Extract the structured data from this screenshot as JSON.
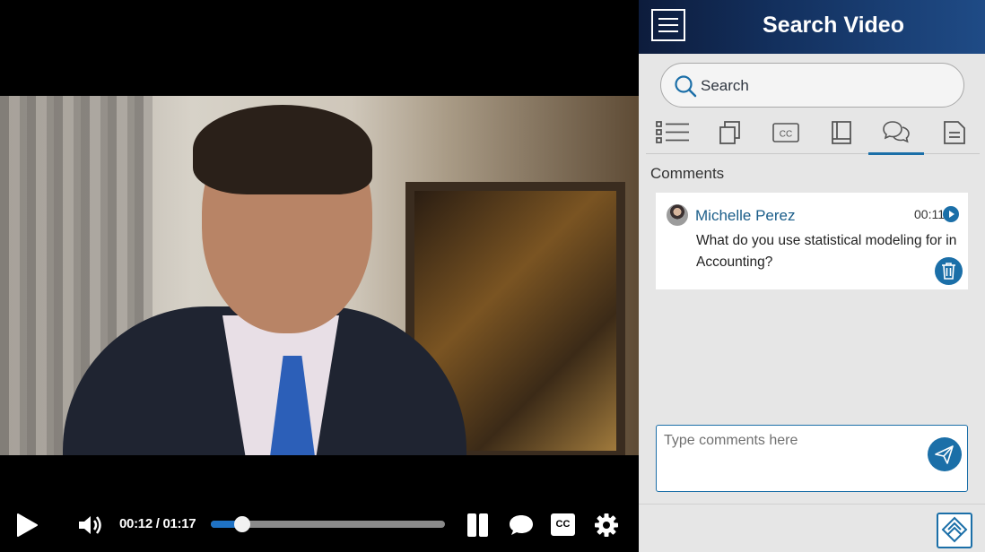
{
  "player": {
    "time_readout": "00:12 / 01:17",
    "progress_fraction": 0.134,
    "icons": {
      "play": "play-icon",
      "volume": "volume-icon",
      "split": "split-view-icon",
      "comment": "comment-icon",
      "cc": "CC",
      "settings": "gear-icon"
    }
  },
  "panel": {
    "title": "Search Video",
    "search": {
      "placeholder": "Search"
    },
    "tabs": [
      {
        "icon": "list-icon"
      },
      {
        "icon": "copy-icon"
      },
      {
        "icon": "cc-icon",
        "label": "CC"
      },
      {
        "icon": "book-icon"
      },
      {
        "icon": "comments-icon",
        "active": true
      },
      {
        "icon": "document-icon"
      }
    ],
    "comments_heading": "Comments",
    "comment": {
      "author": "Michelle Perez",
      "time": "00:11",
      "text": "What do you use statistical modeling for in Accounting?"
    },
    "comment_input": {
      "placeholder": "Type comments here"
    },
    "colors": {
      "accent": "#1b6fa8",
      "header_start": "#0d1c3c",
      "header_end": "#1f4b86"
    }
  }
}
